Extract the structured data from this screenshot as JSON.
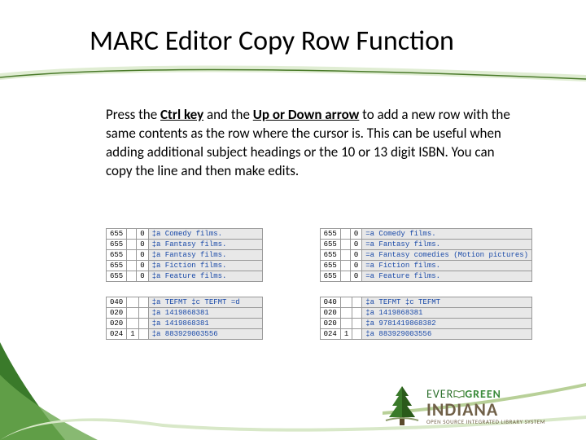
{
  "title": "MARC Editor Copy Row Function",
  "body": {
    "pre": "Press the ",
    "bold1": "Ctrl key",
    "mid1": " and the ",
    "bold2": "Up or Down arrow",
    "post": " to add a new row with the same  contents as the row where the cursor is. This can be useful when adding additional subject headings or the 10 or 13 digit ISBN. You can copy the line and then make edits."
  },
  "left_655": [
    {
      "tag": "655",
      "i1": "",
      "i2": "0",
      "c": "‡a Comedy films."
    },
    {
      "tag": "655",
      "i1": "",
      "i2": "0",
      "c": "‡a Fantasy films."
    },
    {
      "tag": "655",
      "i1": "",
      "i2": "0",
      "c": "‡a Fantasy films."
    },
    {
      "tag": "655",
      "i1": "",
      "i2": "0",
      "c": "‡a Fiction films."
    },
    {
      "tag": "655",
      "i1": "",
      "i2": "0",
      "c": "‡a Feature films."
    }
  ],
  "right_655": [
    {
      "tag": "655",
      "i1": "",
      "i2": "0",
      "c": "=a Comedy films."
    },
    {
      "tag": "655",
      "i1": "",
      "i2": "0",
      "c": "=a Fantasy films."
    },
    {
      "tag": "655",
      "i1": "",
      "i2": "0",
      "c": "=a Fantasy comedies (Motion pictures)"
    },
    {
      "tag": "655",
      "i1": "",
      "i2": "0",
      "c": "=a Fiction films."
    },
    {
      "tag": "655",
      "i1": "",
      "i2": "0",
      "c": "=a Feature films."
    }
  ],
  "left_02x": [
    {
      "tag": "040",
      "i1": "",
      "i2": "",
      "c": "‡a TEFMT  ‡c TEFMT  =d"
    },
    {
      "tag": "020",
      "i1": "",
      "i2": "",
      "c": "‡a 1419868381"
    },
    {
      "tag": "020",
      "i1": "",
      "i2": "",
      "c": "‡a 1419868381"
    },
    {
      "tag": "024",
      "i1": "1",
      "i2": "",
      "c": "‡a 883929003556"
    }
  ],
  "right_02x": [
    {
      "tag": "040",
      "i1": "",
      "i2": "",
      "c": "‡a TEFMT  ‡c TEFMT"
    },
    {
      "tag": "020",
      "i1": "",
      "i2": "",
      "c": "‡a 1419868381"
    },
    {
      "tag": "020",
      "i1": "",
      "i2": "",
      "c": "‡a 9781419868382"
    },
    {
      "tag": "024",
      "i1": "1",
      "i2": "",
      "c": "‡a 883929003556"
    }
  ],
  "logo": {
    "line1a": "EVER",
    "line1b": "GREEN",
    "line2": "INDIANA",
    "line3": "OPEN SOURCE INTEGRATED LIBRARY SYSTEM"
  }
}
